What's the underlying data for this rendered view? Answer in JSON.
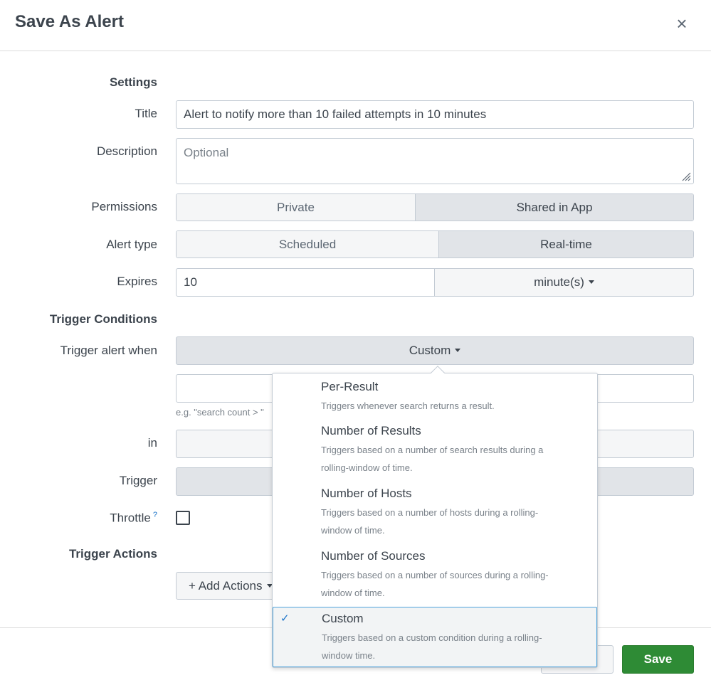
{
  "dialog": {
    "title": "Save As Alert",
    "close_glyph": "×"
  },
  "settings": {
    "section_label": "Settings",
    "title_label": "Title",
    "title_value": "Alert to notify more than 10 failed attempts in 10 minutes",
    "description_label": "Description",
    "description_placeholder": "Optional",
    "permissions_label": "Permissions",
    "permissions_options": [
      "Private",
      "Shared in App"
    ],
    "permissions_selected": "Shared in App",
    "alert_type_label": "Alert type",
    "alert_type_options": [
      "Scheduled",
      "Real-time"
    ],
    "alert_type_selected": "Real-time",
    "expires_label": "Expires",
    "expires_value": "10",
    "expires_unit": "minute(s)"
  },
  "trigger": {
    "section_label": "Trigger Conditions",
    "when_label": "Trigger alert when",
    "when_value": "Custom",
    "hint_text": "e.g. \"search count > \"",
    "in_label": "in",
    "trigger_label": "Trigger",
    "throttle_label": "Throttle",
    "throttle_help": "?"
  },
  "actions": {
    "section_label": "Trigger Actions",
    "add_actions_label": "+ Add Actions"
  },
  "footer": {
    "save_label": "Save"
  },
  "menu": {
    "items": [
      {
        "title": "Per-Result",
        "desc_lines": [
          "Triggers whenever search returns a result."
        ]
      },
      {
        "title": "Number of Results",
        "desc_lines": [
          "Triggers based on a number of search results during a",
          "rolling-window of time."
        ]
      },
      {
        "title": "Number of Hosts",
        "desc_lines": [
          "Triggers based on a number of hosts during a rolling-",
          "window of time."
        ]
      },
      {
        "title": "Number of Sources",
        "desc_lines": [
          "Triggers based on a number of sources during a rolling-",
          "window of time."
        ]
      },
      {
        "title": "Custom",
        "desc_lines": [
          "Triggers based on a custom condition during a rolling-",
          "window time."
        ]
      }
    ],
    "selected": "Custom",
    "check_glyph": "✓"
  },
  "colors": {
    "save_green": "#2e8b35",
    "selected_border": "#4ea3db",
    "active_segment": "#e1e4e8"
  }
}
